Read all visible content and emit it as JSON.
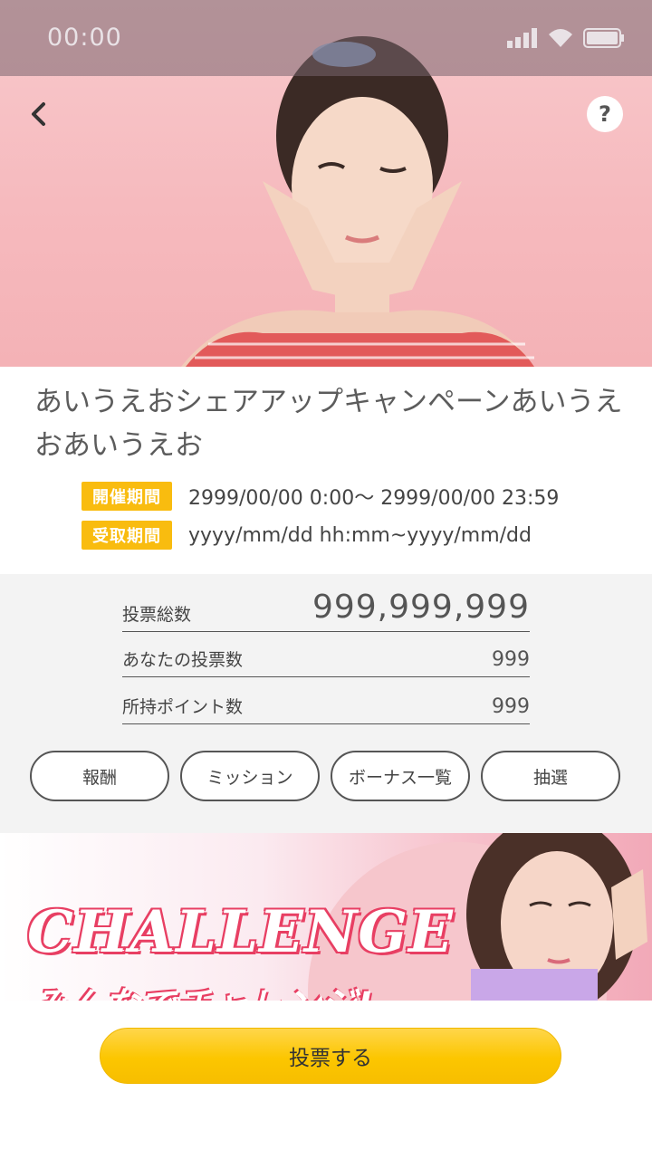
{
  "status": {
    "time": "00:00"
  },
  "header": {
    "back_icon": "chevron-left-icon",
    "help_label": "?"
  },
  "campaign": {
    "title": "あいうえおシェアアップキャンペーンあいうえおあいうえお",
    "periods": [
      {
        "label": "開催期間",
        "value": "2999/00/00 0:00～ 2999/00/00 23:59"
      },
      {
        "label": "受取期間",
        "value": "yyyy/mm/dd hh:mm~yyyy/mm/dd"
      }
    ]
  },
  "stats": [
    {
      "label": "投票総数",
      "value": "999,999,999"
    },
    {
      "label": "あなたの投票数",
      "value": "999"
    },
    {
      "label": "所持ポイント数",
      "value": "999"
    }
  ],
  "tabs": [
    "報酬",
    "ミッション",
    "ボーナス一覧",
    "抽選"
  ],
  "banner": {
    "title": "CHALLENGE",
    "subtitle": "みんなでチャレンジ!"
  },
  "vote_button": "投票する",
  "colors": {
    "accent": "#f9bc0f",
    "vote": "#fcc600",
    "banner_red": "#e83f63"
  }
}
